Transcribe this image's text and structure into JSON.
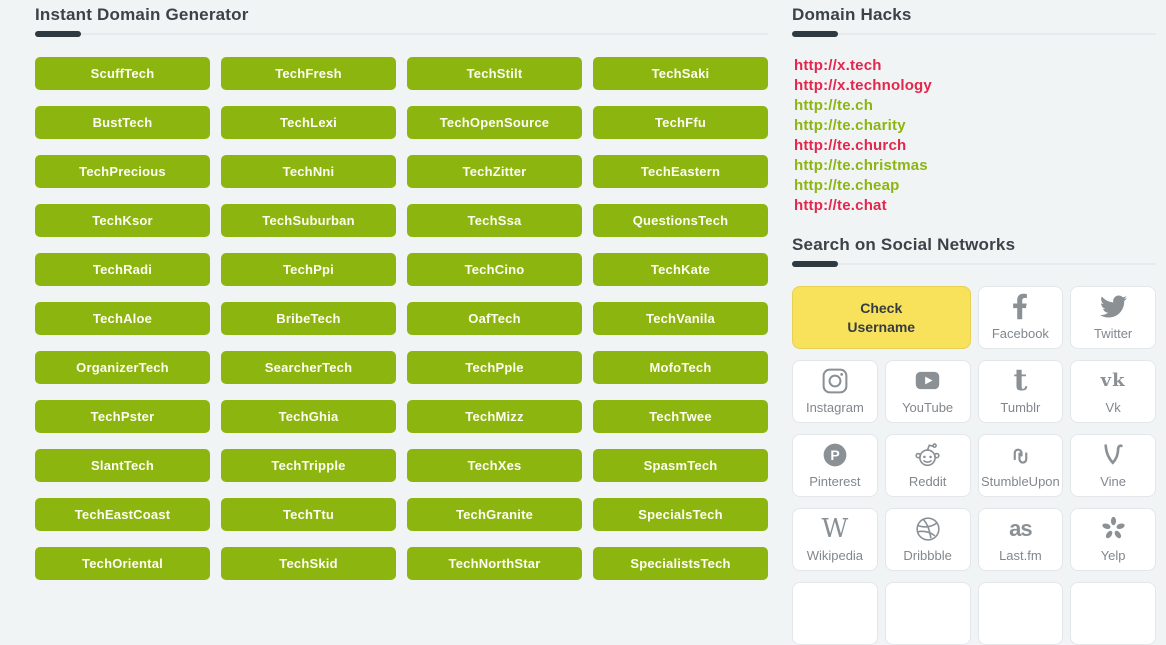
{
  "generator": {
    "title": "Instant Domain Generator",
    "suggestions": [
      "ScuffTech",
      "TechFresh",
      "TechStilt",
      "TechSaki",
      "BustTech",
      "TechLexi",
      "TechOpenSource",
      "TechFfu",
      "TechPrecious",
      "TechNni",
      "TechZitter",
      "TechEastern",
      "TechKsor",
      "TechSuburban",
      "TechSsa",
      "QuestionsTech",
      "TechRadi",
      "TechPpi",
      "TechCino",
      "TechKate",
      "TechAloe",
      "BribeTech",
      "OafTech",
      "TechVanila",
      "OrganizerTech",
      "SearcherTech",
      "TechPple",
      "MofoTech",
      "TechPster",
      "TechGhia",
      "TechMizz",
      "TechTwee",
      "SlantTech",
      "TechTripple",
      "TechXes",
      "SpasmTech",
      "TechEastCoast",
      "TechTtu",
      "TechGranite",
      "SpecialsTech",
      "TechOriental",
      "TechSkid",
      "TechNorthStar",
      "SpecialistsTech"
    ]
  },
  "domain_hacks": {
    "title": "Domain Hacks",
    "links": [
      {
        "url": "http://x.tech",
        "color": "#e2264d"
      },
      {
        "url": "http://x.technology",
        "color": "#e2264d"
      },
      {
        "url": "http://te.ch",
        "color": "#8cb512"
      },
      {
        "url": "http://te.charity",
        "color": "#8cb512"
      },
      {
        "url": "http://te.church",
        "color": "#e2264d"
      },
      {
        "url": "http://te.christmas",
        "color": "#8cb512"
      },
      {
        "url": "http://te.cheap",
        "color": "#8cb512"
      },
      {
        "url": "http://te.chat",
        "color": "#e2264d"
      }
    ]
  },
  "social": {
    "title": "Search on Social Networks",
    "check_username_label": "Check Username",
    "networks": [
      {
        "label": "Facebook",
        "icon": "facebook-icon"
      },
      {
        "label": "Twitter",
        "icon": "twitter-icon"
      },
      {
        "label": "Instagram",
        "icon": "instagram-icon"
      },
      {
        "label": "YouTube",
        "icon": "youtube-icon"
      },
      {
        "label": "Tumblr",
        "icon": "tumblr-icon"
      },
      {
        "label": "Vk",
        "icon": "vk-icon"
      },
      {
        "label": "Pinterest",
        "icon": "pinterest-icon"
      },
      {
        "label": "Reddit",
        "icon": "reddit-icon"
      },
      {
        "label": "StumbleUpon",
        "icon": "stumbleupon-icon"
      },
      {
        "label": "Vine",
        "icon": "vine-icon"
      },
      {
        "label": "Wikipedia",
        "icon": "wikipedia-icon"
      },
      {
        "label": "Dribbble",
        "icon": "dribbble-icon"
      },
      {
        "label": "Last.fm",
        "icon": "lastfm-icon"
      },
      {
        "label": "Yelp",
        "icon": "yelp-icon"
      }
    ]
  },
  "colors": {
    "button_green": "#8db510",
    "check_yellow": "#f8e25b",
    "link_red": "#e2264d",
    "link_green": "#8cb512"
  }
}
